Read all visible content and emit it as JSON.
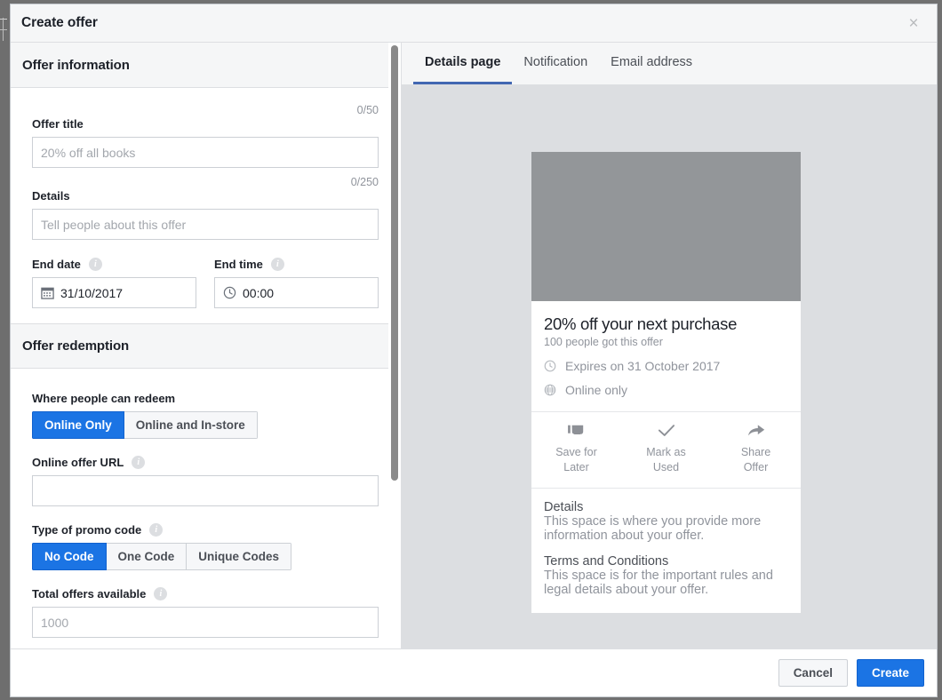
{
  "dialog": {
    "title": "Create offer",
    "close_label": "×"
  },
  "left_panel": {
    "offer_information": {
      "heading": "Offer information",
      "title_counter": "0/50",
      "title_label": "Offer title",
      "title_value": "",
      "title_placeholder": "20% off all books",
      "details_counter": "0/250",
      "details_label": "Details",
      "details_value": "",
      "details_placeholder": "Tell people about this offer",
      "end_date_label": "End date",
      "end_date_value": "31/10/2017",
      "end_time_label": "End time",
      "end_time_value": "00:00"
    },
    "offer_redemption": {
      "heading": "Offer redemption",
      "redeem_label": "Where people can redeem",
      "redeem_options": [
        "Online Only",
        "Online and In-store"
      ],
      "redeem_selected": "Online Only",
      "url_label": "Online offer URL",
      "url_value": "",
      "url_placeholder": "",
      "promo_label": "Type of promo code",
      "promo_options": [
        "No Code",
        "One Code",
        "Unique Codes"
      ],
      "promo_selected": "No Code",
      "total_label": "Total offers available",
      "total_value": "",
      "total_placeholder": "1000"
    },
    "info_icon_glyph": "i"
  },
  "right_panel": {
    "tabs": [
      {
        "label": "Details page",
        "active": true
      },
      {
        "label": "Notification",
        "active": false
      },
      {
        "label": "Email address",
        "active": false
      }
    ],
    "preview_card": {
      "title": "20% off your next purchase",
      "subtitle": "100 people got this offer",
      "expires": "Expires on 31 October 2017",
      "availability": "Online only",
      "actions": [
        {
          "icon": "bookmark-icon",
          "label": "Save for\nLater"
        },
        {
          "icon": "check-icon",
          "label": "Mark as\nUsed"
        },
        {
          "icon": "share-icon",
          "label": "Share\nOffer"
        }
      ],
      "details_heading": "Details",
      "details_text": "This space is where you provide more information about your offer.",
      "terms_heading": "Terms and Conditions",
      "terms_text": "This space is for the important rules and legal details about your offer."
    }
  },
  "footer": {
    "cancel_label": "Cancel",
    "create_label": "Create"
  },
  "colors": {
    "accent_blue": "#1b74e4",
    "tab_underline": "#4267b2",
    "panel_gray": "#dcdee1",
    "image_placeholder": "#939699",
    "header_gray": "#f5f6f7"
  }
}
